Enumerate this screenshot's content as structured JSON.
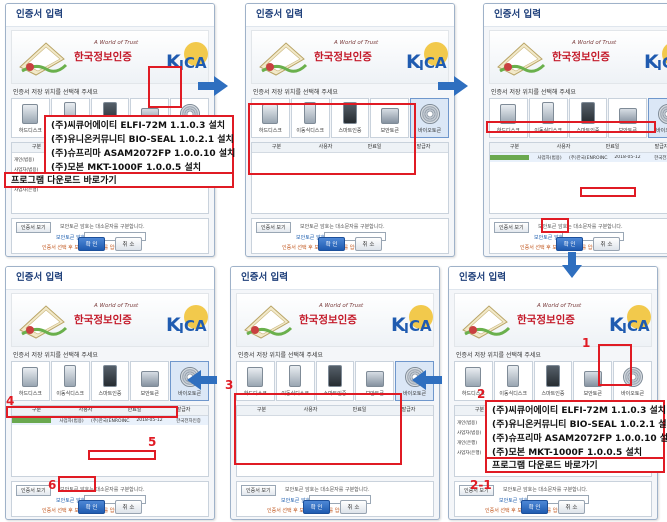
{
  "dialog": {
    "title": "인증서 입력",
    "banner_tagline": "A World of Trust",
    "banner_name": "한국정보인증",
    "prompt": "인증서 저장 위치를 선택해 주세요",
    "media": [
      "하드디스크",
      "이동식디스크",
      "스마트인증",
      "보안토큰",
      "바이오토큰"
    ],
    "table_headers": [
      "구분",
      "사용자",
      "만료일",
      "발급자"
    ],
    "cert_row": [
      "사업자(범용)",
      "(주)한국(ENROINC...",
      "2018-05-12",
      "한국전자인증"
    ],
    "side_labels": [
      "개인(범용)",
      "사업자(범용)",
      "개인(은행)",
      "사업자(은행)"
    ],
    "view_button": "인증서 보기",
    "note": "보안토큰 암호는 대소문자를 구분합니다.",
    "pw_label": "보안토큰 암호",
    "warning": "인증서 선택 후 보안토큰 암호를 입력하세요.",
    "ok_button": "확 인",
    "cancel_button": "취 소"
  },
  "driver_list": [
    "(주)씨큐어에이티 ELFI-72M 1.1.0.3 설치",
    "(주)유니온커뮤니티 BIO-SEAL 1.0.2.1 설치",
    "(주)슈프리마 ASAM2072FP 1.0.0.10 설치",
    "(주)모본 MKT-1000F 1.0.0.5 설치"
  ],
  "download_link": "프로그램 다운로드 바로가기",
  "steps": [
    "1",
    "2",
    "2-1",
    "3",
    "4",
    "5",
    "6"
  ],
  "colors": {
    "highlight": "#e01b24",
    "arrow": "#2f6fbf",
    "accent": "#1f5bb0"
  }
}
